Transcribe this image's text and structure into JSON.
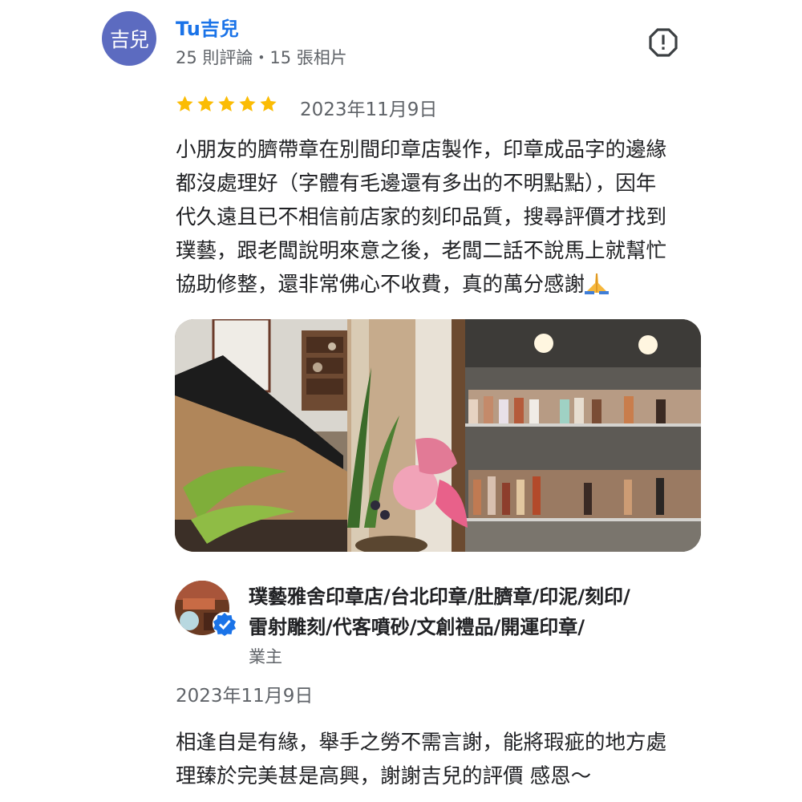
{
  "reviewer": {
    "avatar_text": "吉兒",
    "name": "Tu吉兒",
    "meta": "25 則評論・15 張相片"
  },
  "review": {
    "rating": 5,
    "rating_max": 5,
    "date": "2023年11月9日",
    "text_lines": [
      "小朋友的臍帶章在別間印章店製作，印章成品字的邊緣",
      "都沒處理好（字體有毛邊還有多出的不明點點），因年",
      "代久遠且已不相信前店家的刻印品質，搜尋評價才找到",
      "璞藝，跟老闆說明來意之後，老闆二話不說馬上就幫忙",
      "協助修整，還非常佛心不收費，真的萬分感謝"
    ],
    "photo_icon": "shop-interior-photo"
  },
  "owner_reply": {
    "name_lines": [
      "璞藝雅舍印章店/台北印章/肚臍章/印泥/刻印/",
      "雷射雕刻/代客噴砂/文創禮品/開運印章/"
    ],
    "role": "業主",
    "date": "2023年11月9日",
    "text_lines": [
      "相逢自是有緣，舉手之勞不需言謝，能將瑕疵的地方處",
      "理臻於完美甚是高興，謝謝吉兒的評價 感恩～"
    ]
  },
  "icons": {
    "report": "report-icon",
    "star": "star-icon",
    "pray": "folded-hands-icon",
    "verified": "verified-badge-icon"
  },
  "colors": {
    "avatar_bg": "#5c6bc0",
    "name_link": "#1a73e8",
    "star": "#fbbc04",
    "verified": "#1a73e8",
    "secondary_text": "#5f6368"
  }
}
